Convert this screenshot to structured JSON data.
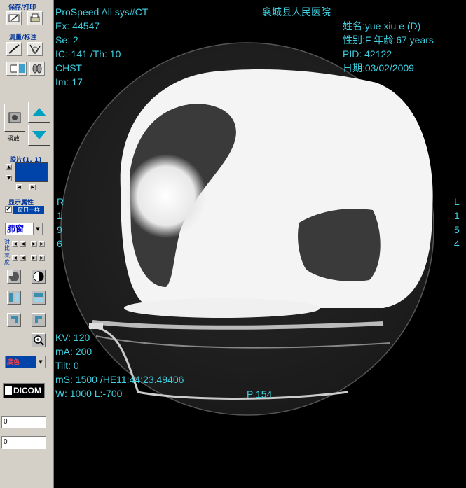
{
  "sidebar": {
    "save_print_title": "保存/打印",
    "measure_title": "测量/标注",
    "play_label": "播放",
    "frame_title": "胶片(1, 1)",
    "display_title": "显示属性",
    "same_checkbox_label": "窗口一样",
    "window_select": "肺窗",
    "contrast_label": "对比",
    "brightness_label": "亮度",
    "color_select": "底色",
    "dicom_label": "DICOM",
    "field1_value": "0",
    "field2_value": "0"
  },
  "viewer": {
    "top_left": [
      "ProSpeed All  sys#CT",
      "Ex: 44547",
      "Se: 2",
      "IC:-141 /Th: 10",
      "CHST",
      "Im: 17"
    ],
    "top_center": "襄城县人民医院",
    "top_right": [
      "姓名:yue xiu e (D)",
      "性别:F  年龄:67 years",
      "PID: 42122",
      "日期:03/02/2009"
    ],
    "left_orient": [
      "R",
      "1",
      "9",
      "6"
    ],
    "right_orient": [
      "L",
      "1",
      "5",
      "4"
    ],
    "bottom_left": [
      "KV: 120",
      "mA: 200",
      "Tilt: 0",
      "mS: 1500  /HE11:44:23.49406",
      "W: 1000 L:-700"
    ],
    "bottom_center": "P 154"
  },
  "colors": {
    "overlay_text": "#3fd0e0",
    "panel_bg": "#d4d0c8",
    "accent_blue": "#0044aa",
    "title_blue": "#003399"
  }
}
